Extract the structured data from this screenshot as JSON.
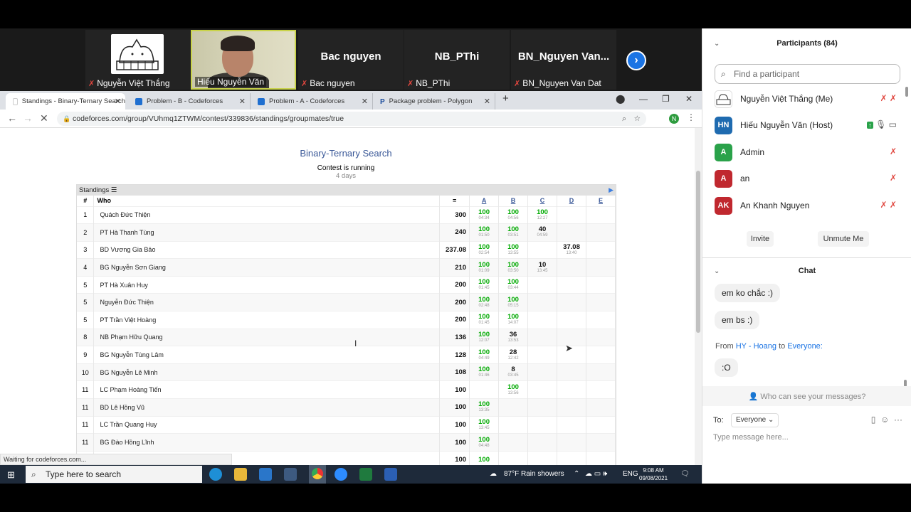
{
  "video": {
    "tiles": [
      {
        "label": "Nguyễn Việt Thắng",
        "display": ""
      },
      {
        "label": "Hiếu Nguyễn Văn",
        "display": ""
      },
      {
        "label": "Bac nguyen",
        "display": "Bac nguyen"
      },
      {
        "label": "NB_PThi",
        "display": "NB_PThi"
      },
      {
        "label": "BN_Nguyen Van Dat",
        "display": "BN_Nguyen Van..."
      }
    ],
    "next_icon": "chevron-right-icon"
  },
  "browser": {
    "tabs": [
      {
        "label": "Standings - Binary-Ternary Search",
        "color": "#ffffff"
      },
      {
        "label": "Problem - B - Codeforces",
        "color": "#1f6fd0"
      },
      {
        "label": "Problem - A - Codeforces",
        "color": "#1f6fd0"
      },
      {
        "label": "Package problem - Polygon",
        "color": "#1b4c9c"
      }
    ],
    "url": "codeforces.com/group/VUhmq1ZTWM/contest/339836/standings/groupmates/true",
    "profile_letter": "N",
    "status": "Waiting for codeforces.com..."
  },
  "contest": {
    "title": "Binary-Ternary Search",
    "status": "Contest is running",
    "days": "4 days",
    "standings_label": "Standings",
    "headers": {
      "rank": "#",
      "who": "Who",
      "points": "=",
      "problems": [
        "A",
        "B",
        "C",
        "D",
        "E"
      ]
    },
    "rows": [
      {
        "rank": "1",
        "name": "Quách Đức Thiện",
        "pts": "300",
        "cells": [
          {
            "v": "100",
            "t": "04:34",
            "c": "green"
          },
          {
            "v": "100",
            "t": "04:56",
            "c": "green"
          },
          {
            "v": "100",
            "t": "12:27",
            "c": "green"
          },
          {
            "v": "",
            "t": "",
            "c": ""
          },
          {
            "v": "",
            "t": "",
            "c": ""
          }
        ]
      },
      {
        "rank": "2",
        "name": "PT Hà Thanh Tùng",
        "pts": "240",
        "cells": [
          {
            "v": "100",
            "t": "01:50",
            "c": "green"
          },
          {
            "v": "100",
            "t": "03:51",
            "c": "green"
          },
          {
            "v": "40",
            "t": "04:59",
            "c": "black"
          },
          {
            "v": "",
            "t": "",
            "c": ""
          },
          {
            "v": "",
            "t": "",
            "c": ""
          }
        ]
      },
      {
        "rank": "3",
        "name": "BD Vương Gia Bảo",
        "pts": "237.08",
        "cells": [
          {
            "v": "100",
            "t": "02:54",
            "c": "green"
          },
          {
            "v": "100",
            "t": "13:55",
            "c": "green"
          },
          {
            "v": "",
            "t": "",
            "c": ""
          },
          {
            "v": "37.08",
            "t": "13:40",
            "c": "black"
          },
          {
            "v": "",
            "t": "",
            "c": ""
          }
        ]
      },
      {
        "rank": "4",
        "name": "BG Nguyễn Sơn Giang",
        "pts": "210",
        "cells": [
          {
            "v": "100",
            "t": "01:09",
            "c": "green"
          },
          {
            "v": "100",
            "t": "03:50",
            "c": "green"
          },
          {
            "v": "10",
            "t": "13:45",
            "c": "black"
          },
          {
            "v": "",
            "t": "",
            "c": ""
          },
          {
            "v": "",
            "t": "",
            "c": ""
          }
        ]
      },
      {
        "rank": "5",
        "name": "PT Hà Xuân Huy",
        "pts": "200",
        "cells": [
          {
            "v": "100",
            "t": "01:45",
            "c": "green"
          },
          {
            "v": "100",
            "t": "03:44",
            "c": "green"
          },
          {
            "v": "",
            "t": "",
            "c": ""
          },
          {
            "v": "",
            "t": "",
            "c": ""
          },
          {
            "v": "",
            "t": "",
            "c": ""
          }
        ]
      },
      {
        "rank": "5",
        "name": "Nguyễn Đức Thiện",
        "pts": "200",
        "cells": [
          {
            "v": "100",
            "t": "02:48",
            "c": "green"
          },
          {
            "v": "100",
            "t": "05:15",
            "c": "green"
          },
          {
            "v": "",
            "t": "",
            "c": ""
          },
          {
            "v": "",
            "t": "",
            "c": ""
          },
          {
            "v": "",
            "t": "",
            "c": ""
          }
        ]
      },
      {
        "rank": "5",
        "name": "PT Trần Việt Hoàng",
        "pts": "200",
        "cells": [
          {
            "v": "100",
            "t": "01:45",
            "c": "green"
          },
          {
            "v": "100",
            "t": "14:07",
            "c": "green"
          },
          {
            "v": "",
            "t": "",
            "c": ""
          },
          {
            "v": "",
            "t": "",
            "c": ""
          },
          {
            "v": "",
            "t": "",
            "c": ""
          }
        ]
      },
      {
        "rank": "8",
        "name": "NB Phạm Hữu Quang",
        "pts": "136",
        "cells": [
          {
            "v": "100",
            "t": "12:07",
            "c": "green"
          },
          {
            "v": "36",
            "t": "13:53",
            "c": "black"
          },
          {
            "v": "",
            "t": "",
            "c": ""
          },
          {
            "v": "",
            "t": "",
            "c": ""
          },
          {
            "v": "",
            "t": "",
            "c": ""
          }
        ]
      },
      {
        "rank": "9",
        "name": "BG Nguyễn Tùng Lâm",
        "pts": "128",
        "cells": [
          {
            "v": "100",
            "t": "04:49",
            "c": "green"
          },
          {
            "v": "28",
            "t": "12:42",
            "c": "black"
          },
          {
            "v": "",
            "t": "",
            "c": ""
          },
          {
            "v": "",
            "t": "",
            "c": ""
          },
          {
            "v": "",
            "t": "",
            "c": ""
          }
        ]
      },
      {
        "rank": "10",
        "name": "BG Nguyễn Lê Minh",
        "pts": "108",
        "cells": [
          {
            "v": "100",
            "t": "01:46",
            "c": "green"
          },
          {
            "v": "8",
            "t": "03:45",
            "c": "black"
          },
          {
            "v": "",
            "t": "",
            "c": ""
          },
          {
            "v": "",
            "t": "",
            "c": ""
          },
          {
            "v": "",
            "t": "",
            "c": ""
          }
        ]
      },
      {
        "rank": "11",
        "name": "LC Phạm Hoàng Tiến",
        "pts": "100",
        "cells": [
          {
            "v": "",
            "t": "",
            "c": ""
          },
          {
            "v": "100",
            "t": "13:56",
            "c": "green"
          },
          {
            "v": "",
            "t": "",
            "c": ""
          },
          {
            "v": "",
            "t": "",
            "c": ""
          },
          {
            "v": "",
            "t": "",
            "c": ""
          }
        ]
      },
      {
        "rank": "11",
        "name": "BD Lê Hồng Vũ",
        "pts": "100",
        "cells": [
          {
            "v": "100",
            "t": "13:35",
            "c": "green"
          },
          {
            "v": "",
            "t": "",
            "c": ""
          },
          {
            "v": "",
            "t": "",
            "c": ""
          },
          {
            "v": "",
            "t": "",
            "c": ""
          },
          {
            "v": "",
            "t": "",
            "c": ""
          }
        ]
      },
      {
        "rank": "11",
        "name": "LC Trần Quang Huy",
        "pts": "100",
        "cells": [
          {
            "v": "100",
            "t": "13:45",
            "c": "green"
          },
          {
            "v": "",
            "t": "",
            "c": ""
          },
          {
            "v": "",
            "t": "",
            "c": ""
          },
          {
            "v": "",
            "t": "",
            "c": ""
          },
          {
            "v": "",
            "t": "",
            "c": ""
          }
        ]
      },
      {
        "rank": "11",
        "name": "BG Đào Hồng Lĩnh",
        "pts": "100",
        "cells": [
          {
            "v": "100",
            "t": "04:48",
            "c": "green"
          },
          {
            "v": "",
            "t": "",
            "c": ""
          },
          {
            "v": "",
            "t": "",
            "c": ""
          },
          {
            "v": "",
            "t": "",
            "c": ""
          },
          {
            "v": "",
            "t": "",
            "c": ""
          }
        ]
      },
      {
        "rank": "",
        "name": "",
        "pts": "100",
        "cells": [
          {
            "v": "100",
            "t": "",
            "c": "green"
          },
          {
            "v": "",
            "t": "",
            "c": ""
          },
          {
            "v": "",
            "t": "",
            "c": ""
          },
          {
            "v": "",
            "t": "",
            "c": ""
          },
          {
            "v": "",
            "t": "",
            "c": ""
          }
        ]
      }
    ]
  },
  "taskbar": {
    "search": "Type here to search",
    "weather": "87°F  Rain showers",
    "lang": "ENG",
    "time": "9:08 AM",
    "date": "09/08/2021"
  },
  "panel": {
    "participants_title": "Participants (84)",
    "find_placeholder": "Find a participant",
    "participants": [
      {
        "name": "Nguyễn Việt Thắng (Me)",
        "initials": "",
        "color": "#ffffff"
      },
      {
        "name": "Hiếu Nguyễn Văn (Host)",
        "initials": "HN",
        "color": "#1f6bb0"
      },
      {
        "name": "Admin",
        "initials": "A",
        "color": "#2aa24a"
      },
      {
        "name": "an",
        "initials": "A",
        "color": "#c0282f"
      },
      {
        "name": "An Khanh Nguyen",
        "initials": "AK",
        "color": "#c0282f"
      }
    ],
    "invite": "Invite",
    "unmute": "Unmute Me",
    "chat_title": "Chat",
    "messages": [
      "em ko chắc :)",
      "em bs :)",
      ":O"
    ],
    "from_label": "From",
    "from_name": "HY - Hoang",
    "to_label": "to",
    "to_name": "Everyone:",
    "who_can_see": "Who can see your messages?",
    "to": "To:",
    "recipient": "Everyone",
    "input_placeholder": "Type message here..."
  }
}
